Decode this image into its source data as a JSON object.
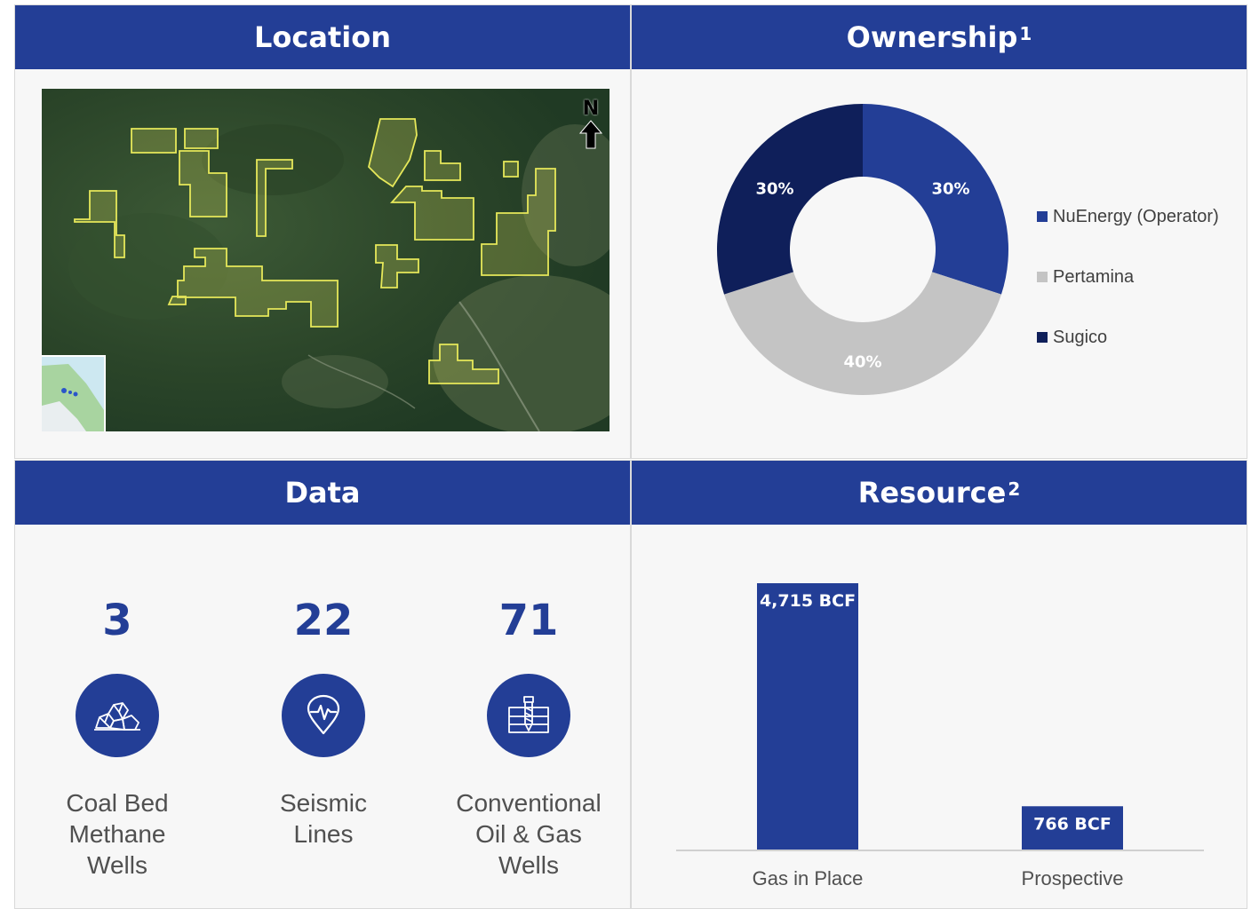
{
  "panels": {
    "location": {
      "title": "Location",
      "north_label": "N"
    },
    "ownership": {
      "title": "Ownership",
      "title_sup": "1"
    },
    "data": {
      "title": "Data"
    },
    "resource": {
      "title": "Resource",
      "title_sup": "2"
    }
  },
  "stats": [
    {
      "value": "3",
      "label_lines": [
        "Coal Bed",
        "Methane",
        "Wells"
      ],
      "icon": "coal-icon"
    },
    {
      "value": "22",
      "label_lines": [
        "Seismic",
        "Lines"
      ],
      "icon": "seismic-icon"
    },
    {
      "value": "71",
      "label_lines": [
        "Conventional",
        "Oil & Gas",
        "Wells"
      ],
      "icon": "drill-icon"
    }
  ],
  "colors": {
    "brand": "#233e96",
    "navy": "#0f1f5a",
    "gray": "#c4c4c4",
    "polygon": "#e6e85a"
  },
  "chart_data": [
    {
      "type": "pie",
      "subtype": "donut",
      "title": "Ownership",
      "slices": [
        {
          "name": "NuEnergy (Operator)",
          "value": 30,
          "label": "30%",
          "color": "#233e96"
        },
        {
          "name": "Pertamina",
          "value": 40,
          "label": "40%",
          "color": "#c4c4c4"
        },
        {
          "name": "Sugico",
          "value": 30,
          "label": "30%",
          "color": "#0f1f5a"
        }
      ],
      "legend": "right"
    },
    {
      "type": "bar",
      "title": "Resource",
      "categories": [
        "Gas in Place",
        "Prospective"
      ],
      "values": [
        4715,
        766
      ],
      "value_labels": [
        "4,715 BCF",
        "766 BCF"
      ],
      "unit": "BCF",
      "color": "#233e96"
    }
  ]
}
